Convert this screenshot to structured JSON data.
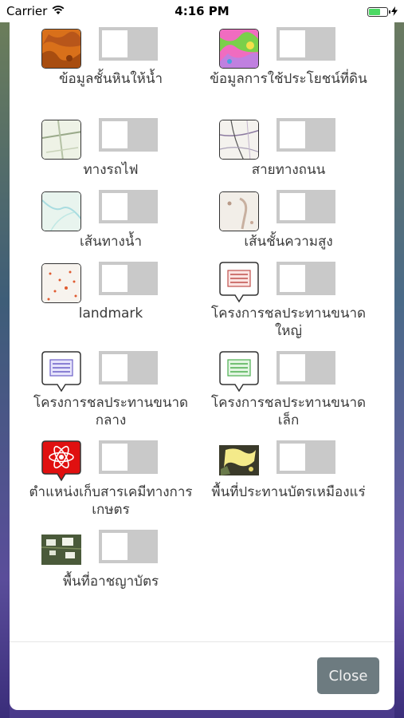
{
  "status_bar": {
    "carrier": "Carrier",
    "time": "4:16 PM",
    "wifi_icon": "wifi-icon",
    "battery_icon": "battery-charging-icon"
  },
  "layers": [
    {
      "key": "groundwater",
      "label": "ข้อมูลชั้นหินให้น้ำ",
      "thumb": "orange-geology-map",
      "enabled": false
    },
    {
      "key": "landuse",
      "label": "ข้อมูลการใช้ประโยชน์ที่ดิน",
      "thumb": "landuse-color-map",
      "enabled": false
    },
    {
      "key": "railway",
      "label": "ทางรถไฟ",
      "thumb": "railway-map",
      "enabled": false
    },
    {
      "key": "road",
      "label": "สายทางถนน",
      "thumb": "road-map",
      "enabled": false
    },
    {
      "key": "waterway",
      "label": "เส้นทางน้ำ",
      "thumb": "waterway-map",
      "enabled": false
    },
    {
      "key": "contour",
      "label": "เส้นชั้นความสูง",
      "thumb": "contour-map",
      "enabled": false
    },
    {
      "key": "landmark",
      "label": "landmark",
      "thumb": "landmark-dots-map",
      "enabled": false
    },
    {
      "key": "irrigation_large",
      "label": "โครงการชลประทานขนาดใหญ่",
      "thumb": "red-project-pin-icon",
      "enabled": false
    },
    {
      "key": "irrigation_medium",
      "label": "โครงการชลประทานขนาดกลาง",
      "thumb": "purple-project-pin-icon",
      "enabled": false
    },
    {
      "key": "irrigation_small",
      "label": "โครงการชลประทานขนาดเล็ก",
      "thumb": "green-project-pin-icon",
      "enabled": false
    },
    {
      "key": "chemical",
      "label": "ตำแหน่งเก็บสารเคมีทางการเกษตร",
      "thumb": "chemical-atom-pin-icon",
      "enabled": false
    },
    {
      "key": "mining",
      "label": "พื้นที่ประทานบัตรเหมืองแร่",
      "thumb": "mining-area-map",
      "enabled": false
    },
    {
      "key": "concession",
      "label": "พื้นที่อาชญาบัตร",
      "thumb": "concession-area-map",
      "enabled": false
    }
  ],
  "footer": {
    "close_label": "Close"
  },
  "colors": {
    "toggle_off": "#c9c9c9",
    "close_button": "#6d7b80",
    "pin_large": "#c0504d",
    "pin_medium": "#6b5fc7",
    "pin_small": "#4caf50",
    "pin_chemical": "#e01010"
  }
}
